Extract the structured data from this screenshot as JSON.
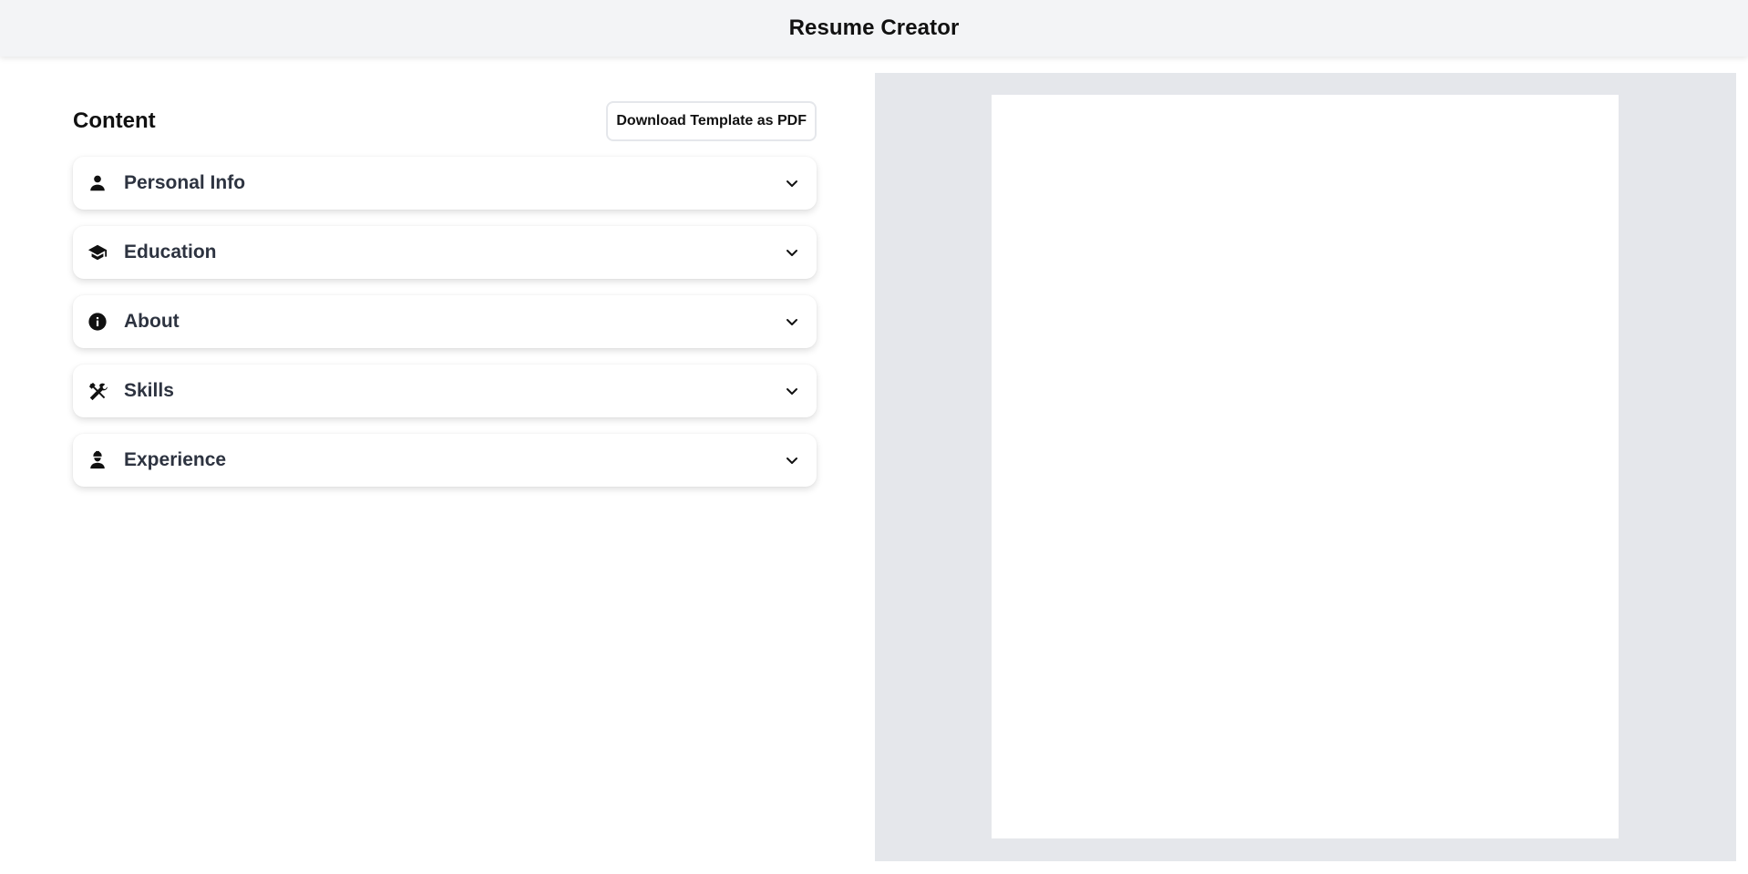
{
  "header": {
    "title": "Resume Creator"
  },
  "editor": {
    "title": "Content",
    "download_label": "Download Template as PDF",
    "sections": [
      {
        "label": "Personal Info",
        "icon": "person-icon"
      },
      {
        "label": "Education",
        "icon": "graduation-cap-icon"
      },
      {
        "label": "About",
        "icon": "info-icon"
      },
      {
        "label": "Skills",
        "icon": "tools-icon"
      },
      {
        "label": "Experience",
        "icon": "engineer-icon"
      }
    ]
  },
  "colors": {
    "topbar_bg": "#f3f4f6",
    "preview_bg": "#e5e7eb",
    "section_label": "#2d3340"
  }
}
